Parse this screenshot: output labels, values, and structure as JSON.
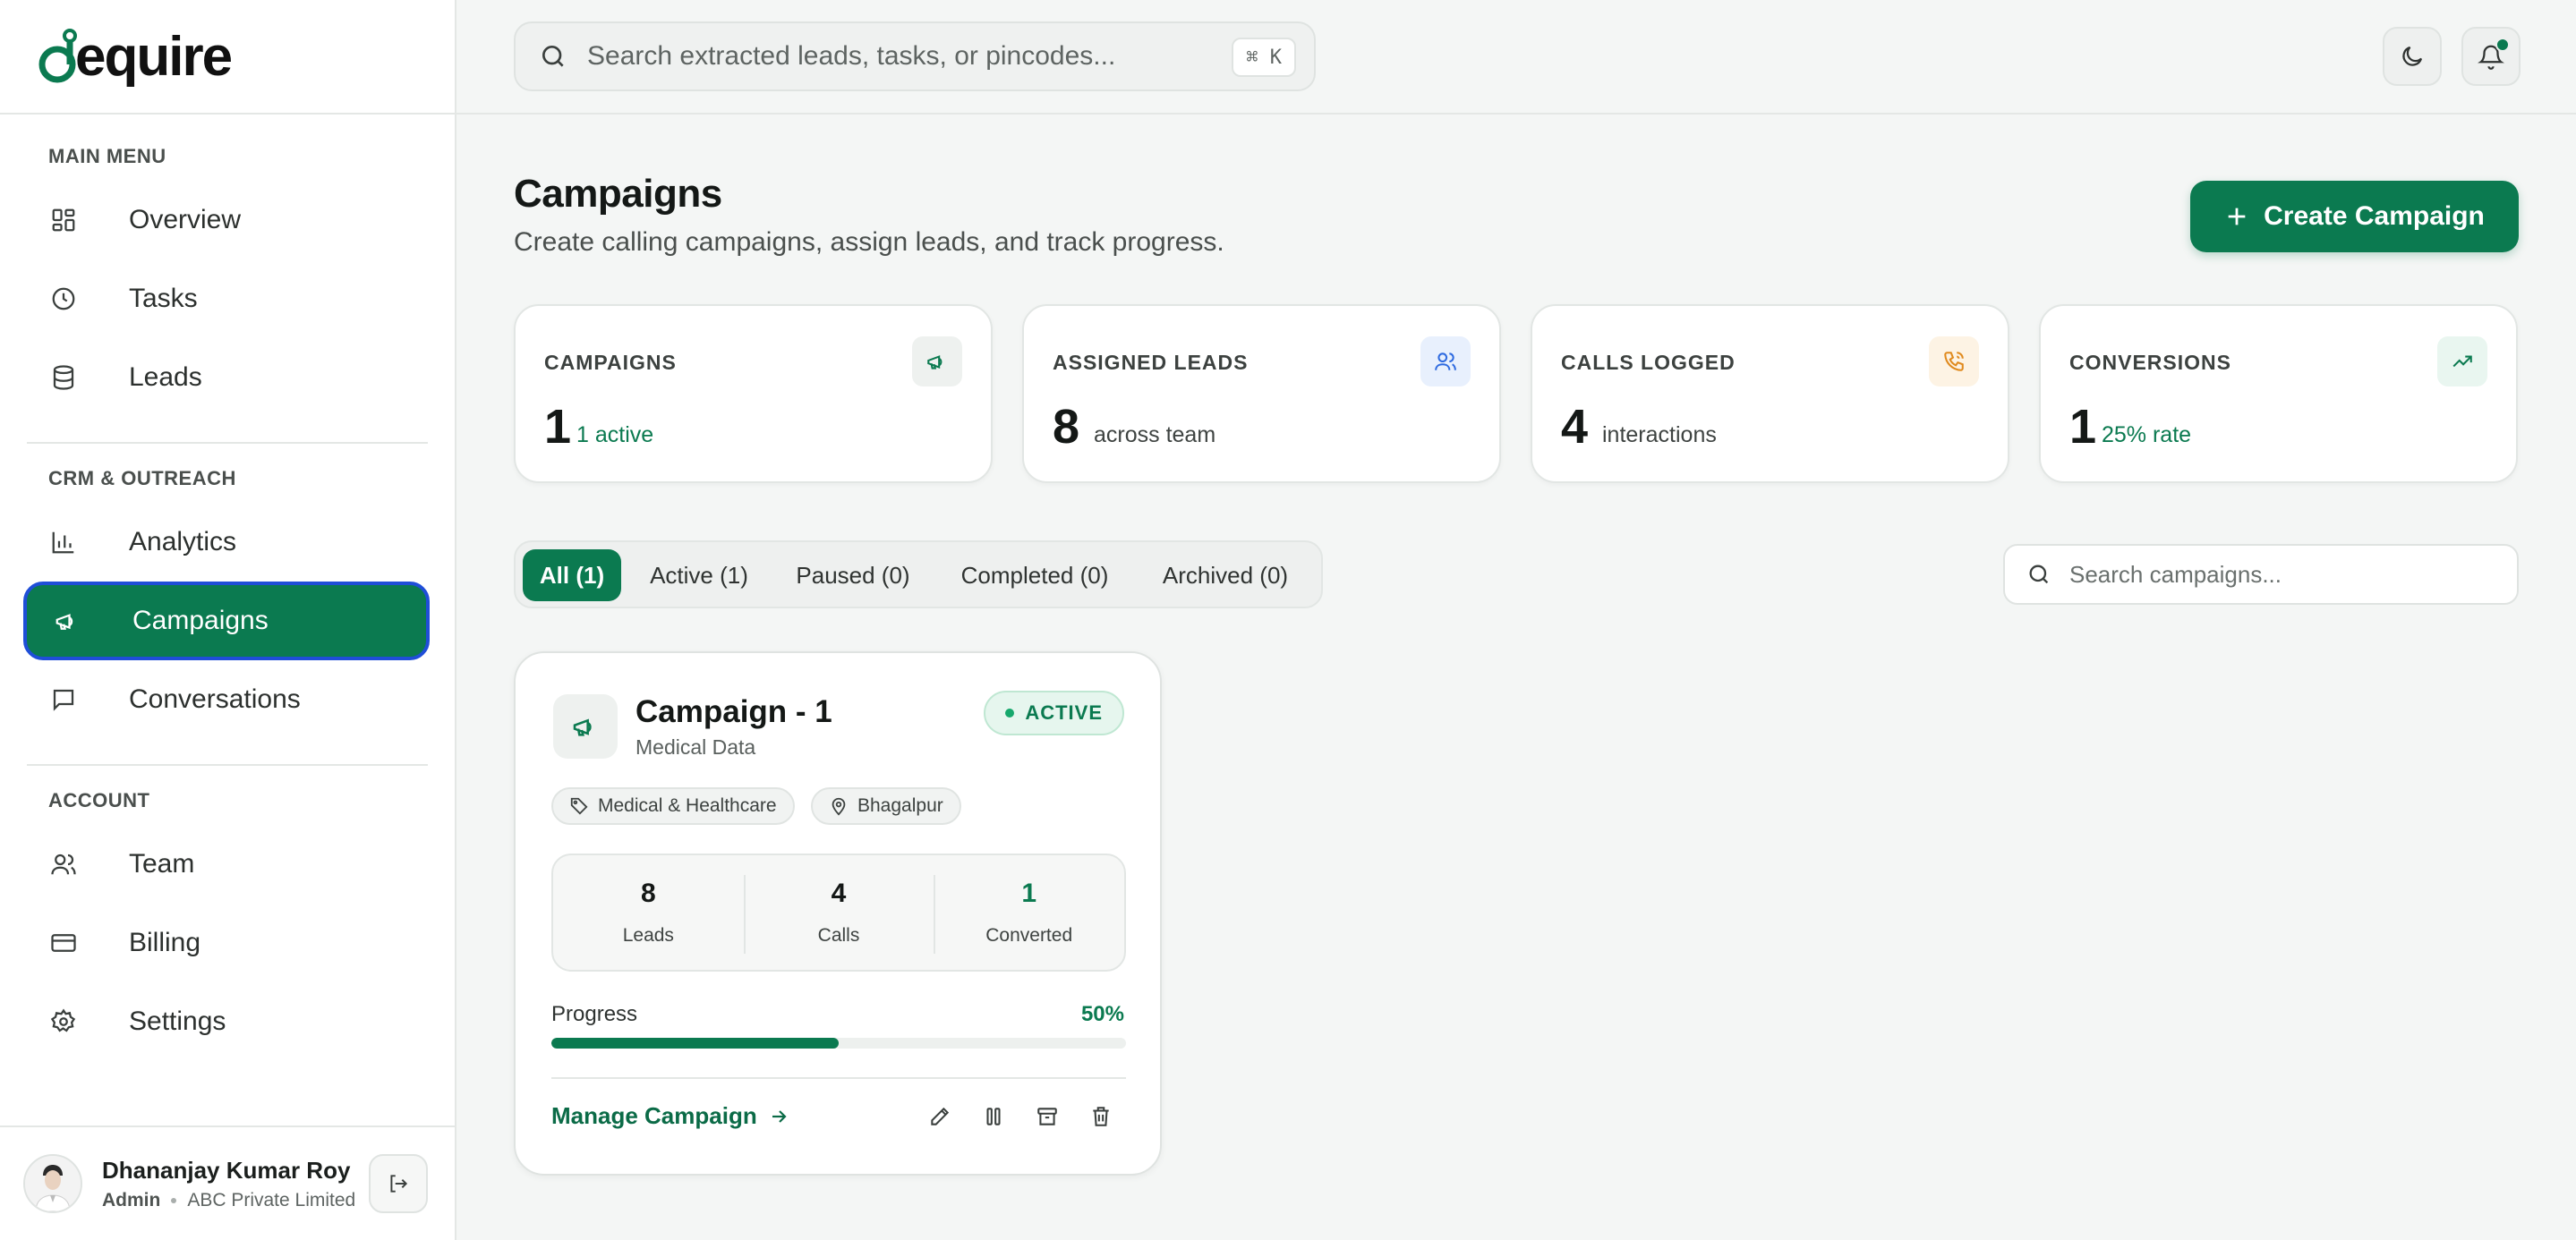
{
  "brand": {
    "logo_text": "dequire",
    "accent": "#0b7a50"
  },
  "topbar": {
    "search_placeholder": "Search extracted leads, tasks, or pincodes...",
    "shortcut": "⌘ K"
  },
  "sidebar": {
    "sections": [
      {
        "label": "MAIN MENU"
      },
      {
        "label": "CRM & OUTREACH"
      },
      {
        "label": "ACCOUNT"
      }
    ],
    "items": [
      {
        "label": "Overview",
        "icon": "grid-icon"
      },
      {
        "label": "Tasks",
        "icon": "clock-icon"
      },
      {
        "label": "Leads",
        "icon": "database-icon"
      },
      {
        "label": "Analytics",
        "icon": "bar-chart-icon"
      },
      {
        "label": "Campaigns",
        "icon": "megaphone-icon",
        "active": true
      },
      {
        "label": "Conversations",
        "icon": "message-icon"
      },
      {
        "label": "Team",
        "icon": "users-icon"
      },
      {
        "label": "Billing",
        "icon": "credit-card-icon"
      },
      {
        "label": "Settings",
        "icon": "gear-icon"
      }
    ],
    "user": {
      "name": "Dhananjay Kumar Roy",
      "role": "Admin",
      "company": "ABC Private Limited"
    }
  },
  "page": {
    "title": "Campaigns",
    "subtitle": "Create calling campaigns, assign leads, and track progress.",
    "create_button": "Create Campaign"
  },
  "stats": [
    {
      "label": "CAMPAIGNS",
      "value": "1",
      "note": "1 active",
      "note_color": "#0b7a50",
      "icon": "megaphone-icon"
    },
    {
      "label": "ASSIGNED LEADS",
      "value": "8",
      "note": "across team",
      "note_color": "#3e4341",
      "icon": "users-icon"
    },
    {
      "label": "CALLS LOGGED",
      "value": "4",
      "note": "interactions",
      "note_color": "#3e4341",
      "icon": "phone-icon"
    },
    {
      "label": "CONVERSIONS",
      "value": "1",
      "note": "25% rate",
      "note_color": "#0b7a50",
      "icon": "trending-up-icon"
    }
  ],
  "filters": {
    "tabs": [
      {
        "label": "All (1)",
        "selected": true
      },
      {
        "label": "Active (1)"
      },
      {
        "label": "Paused (0)"
      },
      {
        "label": "Completed (0)"
      },
      {
        "label": "Archived (0)"
      }
    ],
    "search_placeholder": "Search campaigns..."
  },
  "campaign": {
    "title": "Campaign - 1",
    "subtitle": "Medical Data",
    "status": "ACTIVE",
    "tags": [
      "Medical & Healthcare",
      "Bhagalpur"
    ],
    "metrics": [
      {
        "value": "8",
        "label": "Leads"
      },
      {
        "value": "4",
        "label": "Calls"
      },
      {
        "value": "1",
        "label": "Converted"
      }
    ],
    "progress_label": "Progress",
    "progress_text": "50%",
    "progress": 0.5,
    "manage_label": "Manage Campaign"
  }
}
